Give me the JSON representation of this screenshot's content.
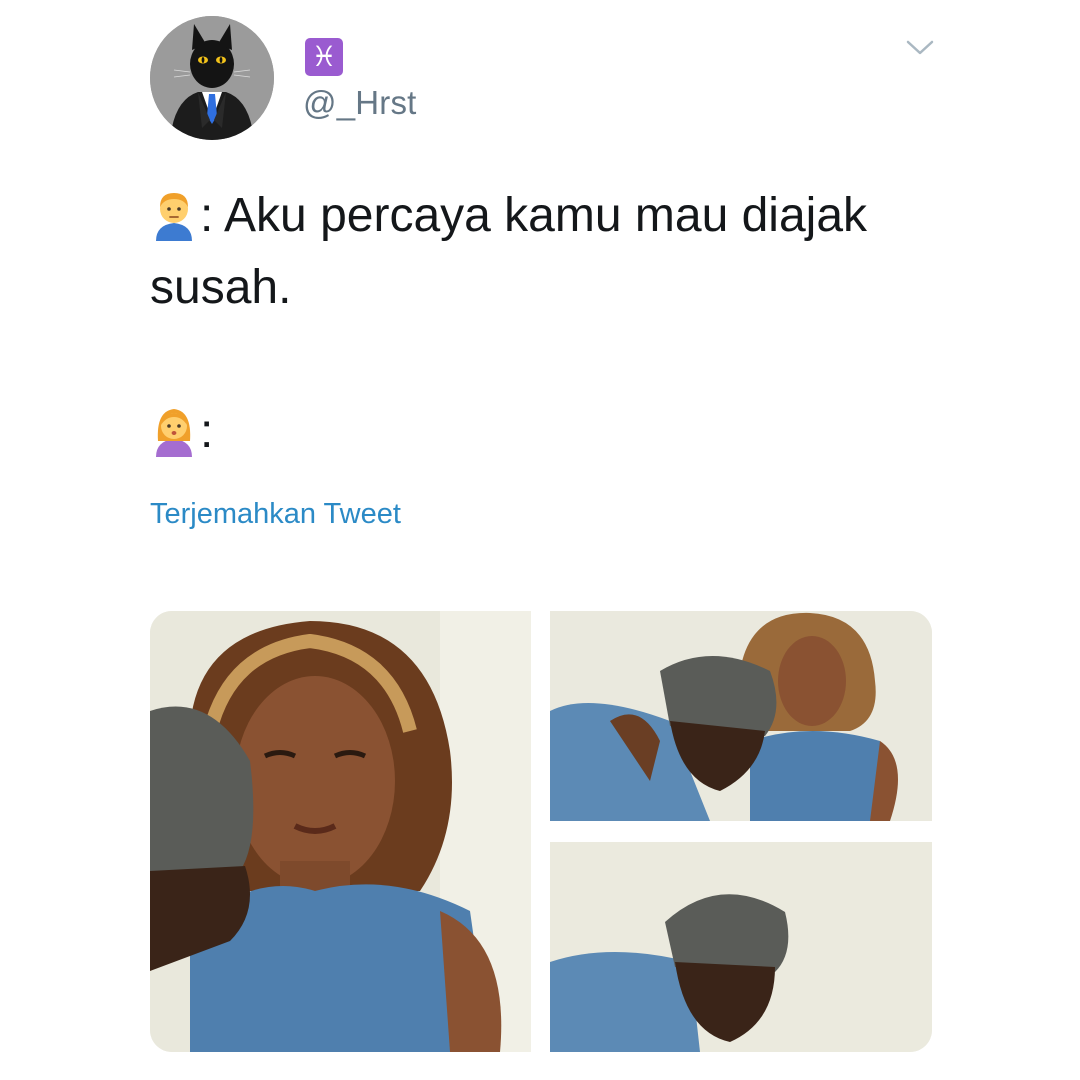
{
  "tweet": {
    "zodiac_symbol": "♓",
    "handle": "@_Hrst",
    "line1_text": ": Aku percaya kamu mau diajak",
    "line2_text": "susah.",
    "line3_text": ":",
    "translate_link": "Terjemahkan Tweet",
    "icons": {
      "avatar": "black-cat-in-suit-avatar",
      "zodiac": "pisces-icon",
      "menu": "chevron-down-icon",
      "emoji_1": "man-emoji",
      "emoji_2": "woman-emoji"
    }
  },
  "colors": {
    "link": "#2b8ac6",
    "handle": "#657786",
    "text": "#14171a",
    "zodiac_bg": "#9a5bd0"
  }
}
